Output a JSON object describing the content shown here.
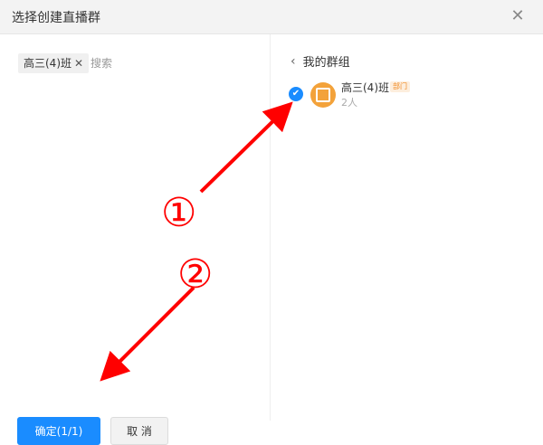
{
  "dialog": {
    "title": "选择创建直播群",
    "close_icon": "close-icon"
  },
  "left": {
    "selected_tag": "高三(4)班",
    "tag_remove": "✕",
    "search_placeholder": "搜索",
    "confirm_label": "确定(1/1)",
    "cancel_label": "取 消"
  },
  "right": {
    "back_icon": "chevron-left-icon",
    "back_label": "我的群组",
    "group": {
      "name": "高三(4)班",
      "badge": "部门",
      "count": "2人",
      "checked": true
    }
  },
  "annotations": {
    "step1": "①",
    "step2": "②",
    "arrow_color": "#ff0000"
  },
  "colors": {
    "accent": "#1a8cff",
    "avatar": "#f3a23a"
  }
}
